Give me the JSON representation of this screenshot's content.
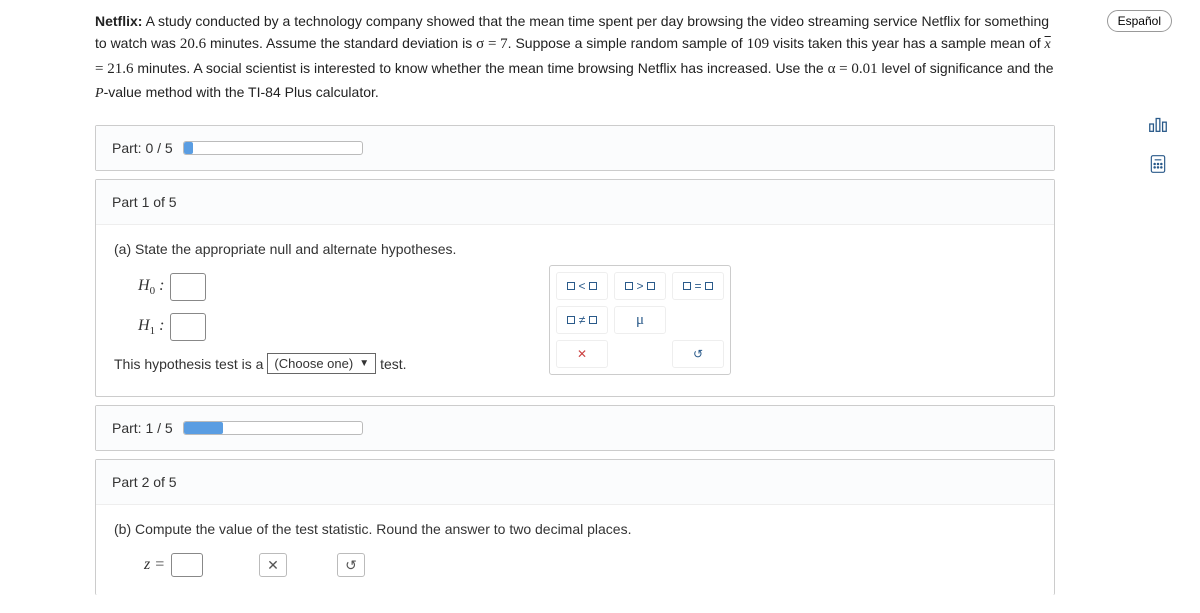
{
  "problem": {
    "title_bold": "Netflix:",
    "text1": " A study conducted by a technology company showed that the mean time spent per day browsing the video streaming service Netflix for something to watch was ",
    "val1": "20.6",
    "text2": " minutes. Assume the standard deviation is ",
    "sigma_eq": "σ = 7",
    "text3": ". Suppose a simple random sample of ",
    "val2": "109",
    "text4": " visits taken this year has a sample mean of ",
    "xbar": "x",
    "xbar_eq": " = 21.6",
    "text5": " minutes. A social scientist is interested to know whether the mean time browsing Netflix has increased. Use the ",
    "alpha_eq": "α = 0.01",
    "text6": " level of significance and the ",
    "pval": "P",
    "text7": "-value method with the TI-84 Plus calculator."
  },
  "espanol": "Español",
  "part0": {
    "label": "Part: 0 / 5",
    "progress_style": "width:5%"
  },
  "part1": {
    "header": "Part 1 of 5",
    "question": "(a) State the appropriate null and alternate hypotheses.",
    "h0_label": "H",
    "h0_sub": "0",
    "h1_label": "H",
    "h1_sub": "1",
    "sentence_pre": "This hypothesis test is a ",
    "dropdown": "(Choose one)",
    "sentence_post": " test."
  },
  "palette": {
    "lt": "<",
    "gt": ">",
    "eq": "=",
    "ne": "≠",
    "mu": "μ",
    "clear": "✕",
    "reset": "↺"
  },
  "partProgress1": {
    "label": "Part: 1 / 5",
    "progress_style": "width:22%"
  },
  "part2": {
    "header": "Part 2 of 5",
    "question": "(b) Compute the value of the test statistic. Round the answer to two decimal places.",
    "z_label": "z =",
    "clear": "✕",
    "reset": "↺"
  }
}
